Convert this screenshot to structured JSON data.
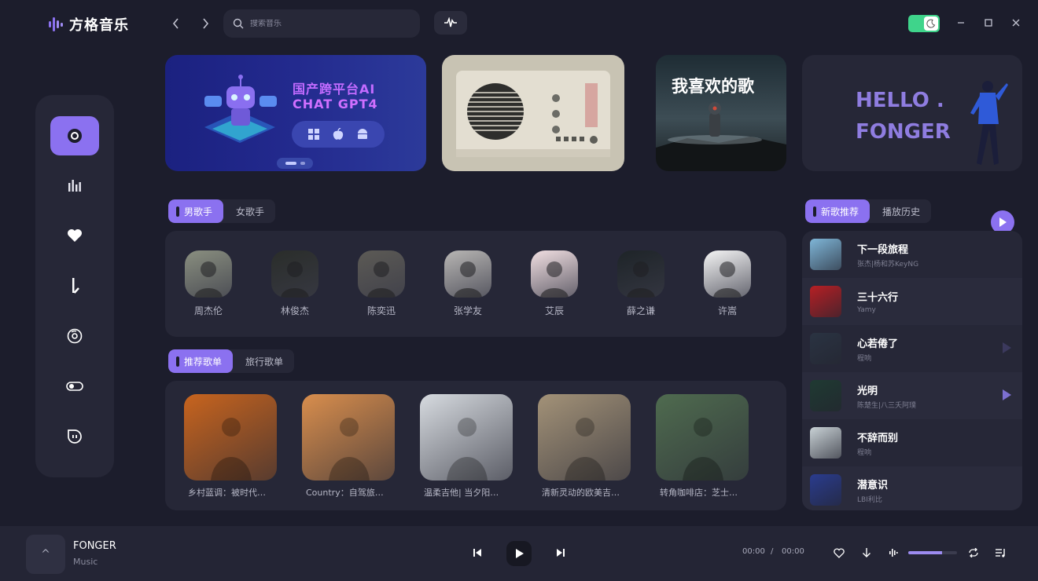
{
  "app": {
    "name": "方格音乐"
  },
  "search": {
    "placeholder": "搜索音乐"
  },
  "colors": {
    "accent": "#8b71f0",
    "background": "#1c1d2c",
    "panel": "#262737",
    "theme_toggle": "#3fd48b"
  },
  "sidebar": {
    "items": [
      {
        "icon": "disc-icon",
        "active": true
      },
      {
        "icon": "chart-bars-icon",
        "active": false
      },
      {
        "icon": "heart-icon",
        "active": false
      },
      {
        "icon": "music-note-icon",
        "active": false
      },
      {
        "icon": "vinyl-icon",
        "active": false
      },
      {
        "icon": "toggle-icon",
        "active": false
      },
      {
        "icon": "face-icon",
        "active": false
      }
    ]
  },
  "banners": {
    "ai": {
      "line1": "国产跨平台AI",
      "line2": "CHAT GPT4",
      "os_icons": [
        "windows-icon",
        "apple-icon",
        "android-icon"
      ]
    },
    "favorite": {
      "title": "我喜欢的歌"
    },
    "hello": {
      "line1": "HELLO .",
      "line2": "FONGER"
    }
  },
  "singers": {
    "tabs": [
      {
        "label": "男歌手",
        "active": true
      },
      {
        "label": "女歌手",
        "active": false
      }
    ],
    "artists": [
      {
        "name": "周杰伦",
        "color": "#8a8f80"
      },
      {
        "name": "林俊杰",
        "color": "#2a2d2a"
      },
      {
        "name": "陈奕迅",
        "color": "#5c5a55"
      },
      {
        "name": "张学友",
        "color": "#b8b6b4"
      },
      {
        "name": "艾辰",
        "color": "#f1dfe2"
      },
      {
        "name": "薛之谦",
        "color": "#1e2428"
      },
      {
        "name": "许嵩",
        "color": "#f5f5f5"
      }
    ]
  },
  "playlists": {
    "tabs": [
      {
        "label": "推荐歌单",
        "active": true
      },
      {
        "label": "旅行歌单",
        "active": false
      }
    ],
    "items": [
      {
        "name": "乡村蓝调：被时代…",
        "color": "#c8641e"
      },
      {
        "name": "Country：自驾旅…",
        "color": "#d98e4d"
      },
      {
        "name": "温柔吉他| 当夕阳…",
        "color": "#d7dbe0"
      },
      {
        "name": "清新灵动的欧美吉…",
        "color": "#a39278"
      },
      {
        "name": "转角咖啡店：芝士…",
        "color": "#4f6b4f"
      }
    ]
  },
  "songs": {
    "tabs": [
      {
        "label": "新歌推荐",
        "active": true
      },
      {
        "label": "播放历史",
        "active": false
      }
    ],
    "items": [
      {
        "title": "下一段旅程",
        "artist": "张杰|杨和苏KeyNG",
        "color": "#7fb6d8",
        "play_icon": ""
      },
      {
        "title": "三十六行",
        "artist": "Yamy",
        "color": "#b61f24",
        "play_icon": ""
      },
      {
        "title": "心若倦了",
        "artist": "程响",
        "color": "#2a3342",
        "play_icon": "faint"
      },
      {
        "title": "光明",
        "artist": "陈楚生|八三夭阿璞",
        "color": "#1f3a32",
        "play_icon": "visible"
      },
      {
        "title": "不辞而别",
        "artist": "程响",
        "color": "#c9d2d6",
        "play_icon": ""
      },
      {
        "title": "潜意识",
        "artist": "LBI利比",
        "color": "#2a3c8e",
        "play_icon": ""
      }
    ]
  },
  "player": {
    "title": "FONGER",
    "subtitle": "Music",
    "expand_label": "^",
    "current_time": "00:00",
    "separator": "/",
    "total_time": "00:00",
    "volume": 0.7
  }
}
